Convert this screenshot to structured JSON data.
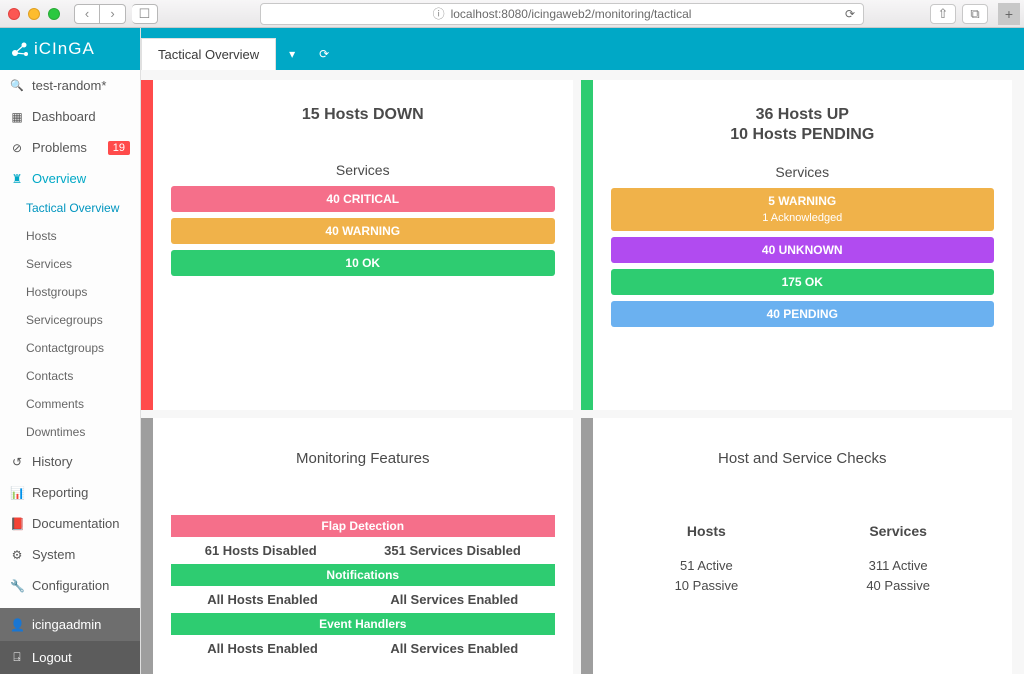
{
  "browser": {
    "url": "localhost:8080/icingaweb2/monitoring/tactical"
  },
  "brand": "iCInGA",
  "nav": {
    "search": "test-random*",
    "dashboard": "Dashboard",
    "problems": "Problems",
    "problems_badge": "19",
    "overview": "Overview",
    "sub": [
      "Tactical Overview",
      "Hosts",
      "Services",
      "Hostgroups",
      "Servicegroups",
      "Contactgroups",
      "Contacts",
      "Comments",
      "Downtimes"
    ],
    "history": "History",
    "reporting": "Reporting",
    "documentation": "Documentation",
    "system": "System",
    "configuration": "Configuration",
    "user": "icingaadmin",
    "logout": "Logout"
  },
  "tabs": {
    "active": "Tactical Overview"
  },
  "panel_down": {
    "title": "15 Hosts DOWN",
    "section": "Services",
    "critical": "40 CRITICAL",
    "warning": "40 WARNING",
    "ok": "10 OK"
  },
  "panel_up": {
    "title1": "36 Hosts UP",
    "title2": "10 Hosts PENDING",
    "section": "Services",
    "warning": "5 WARNING",
    "ack": "1 Acknowledged",
    "unknown": "40 UNKNOWN",
    "ok": "175 OK",
    "pending": "40 PENDING"
  },
  "monfeat": {
    "title": "Monitoring Features",
    "flap": "Flap Detection",
    "flap_h": "61 Hosts Disabled",
    "flap_s": "351 Services Disabled",
    "notif": "Notifications",
    "notif_h": "All Hosts Enabled",
    "notif_s": "All Services Enabled",
    "evh": "Event Handlers",
    "evh_h": "All Hosts Enabled",
    "evh_s": "All Services Enabled"
  },
  "checks": {
    "title": "Host and Service Checks",
    "hosts_h": "Hosts",
    "hosts_a": "51 Active",
    "hosts_p": "10 Passive",
    "services_h": "Services",
    "services_a": "311 Active",
    "services_p": "40 Passive"
  }
}
